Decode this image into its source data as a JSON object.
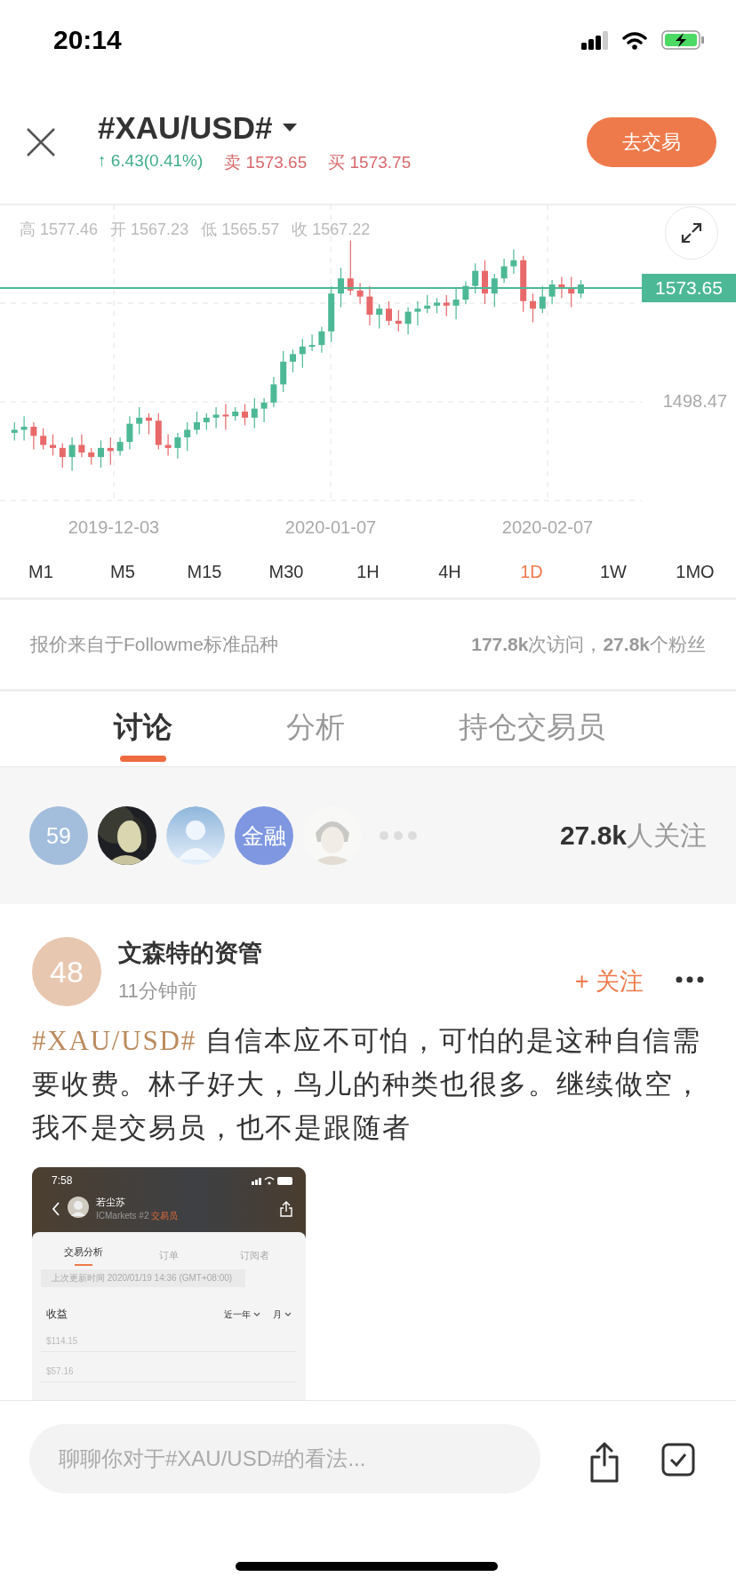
{
  "status_bar": {
    "time": "20:14"
  },
  "header": {
    "title": "#XAU/USD#",
    "change": "↑ 6.43(0.41%)",
    "sell": "卖 1573.65",
    "buy": "买 1573.75",
    "trade_button": "去交易"
  },
  "chart": {
    "ohlc": [
      "高 1577.46",
      "开 1567.23",
      "低 1565.57",
      "收 1567.22"
    ],
    "price_tag": "1573.65",
    "y_label": "1498.47",
    "dates": [
      "2019-12-03",
      "2020-01-07",
      "2020-02-07"
    ]
  },
  "timeframes": [
    {
      "label": "M1",
      "selected": false
    },
    {
      "label": "M5",
      "selected": false
    },
    {
      "label": "M15",
      "selected": false
    },
    {
      "label": "M30",
      "selected": false
    },
    {
      "label": "1H",
      "selected": false
    },
    {
      "label": "4H",
      "selected": false
    },
    {
      "label": "1D",
      "selected": true
    },
    {
      "label": "1W",
      "selected": false
    },
    {
      "label": "1MO",
      "selected": false
    }
  ],
  "info": {
    "source": "报价来自于Followme标准品种",
    "stats": "**177.8k**次访问，**27.8k**个粉丝"
  },
  "tabs": [
    {
      "label": "讨论",
      "selected": true
    },
    {
      "label": "分析",
      "selected": false
    },
    {
      "label": "持仓交易员",
      "selected": false
    }
  ],
  "followers": {
    "avatars": [
      {
        "kind": "text",
        "text": "59",
        "color": "#a3bddc"
      },
      {
        "kind": "picture"
      },
      {
        "kind": "default"
      },
      {
        "kind": "text",
        "text": "金融",
        "color": "#7e97e0"
      },
      {
        "kind": "picture"
      }
    ],
    "count": "**27.8k**人关注"
  },
  "post": {
    "avatar_text": "48",
    "author": "文森特的资管",
    "time": "11分钟前",
    "follow_button": "+ 关注",
    "hashtag": "#XAU/USD#",
    "text": "自信本应不可怕，可怕的是这种自信需要收费。林子好大，鸟儿的种类也很多。继续做空，我不是交易员，也不是跟随者",
    "image": {
      "time": "7:58",
      "name": "若尘苏",
      "broker": "ICMarkets #2",
      "role": "交易员",
      "tabs": [
        {
          "label": "交易分析",
          "selected": true
        },
        {
          "label": "订单",
          "selected": false
        },
        {
          "label": "订阅者",
          "selected": false
        }
      ],
      "updated": "上次更新时间 2020/01/19 14:36 (GMT+08:00)",
      "section": "收益",
      "filters": [
        "近一年",
        "月"
      ],
      "y_labels": [
        "$114.15",
        "$57.16"
      ]
    }
  },
  "comment_box": {
    "placeholder": "聊聊你对于#XAU/USD#的看法..."
  }
}
